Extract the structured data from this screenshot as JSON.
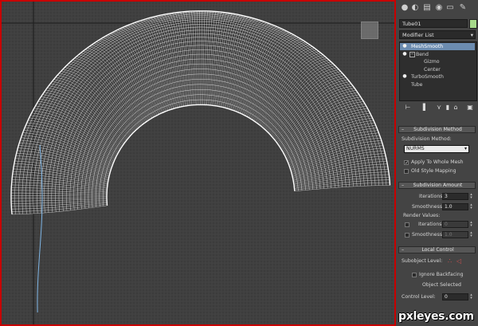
{
  "panel": {
    "object_name": "Tube01",
    "modifier_list": "Modifier List",
    "stack": [
      {
        "label": "MeshSmooth",
        "selected": true,
        "bulb": true,
        "expand": false
      },
      {
        "label": "Bend",
        "selected": false,
        "bulb": true,
        "expand": true
      },
      {
        "label": "Gizmo",
        "selected": false,
        "bulb": false,
        "expand": false
      },
      {
        "label": "Center",
        "selected": false,
        "bulb": false,
        "expand": false
      },
      {
        "label": "TurboSmooth",
        "selected": false,
        "bulb": true,
        "expand": false
      },
      {
        "label": "Tube",
        "selected": false,
        "bulb": false,
        "expand": false
      }
    ],
    "subdivision_method": {
      "title": "Subdivision Method",
      "field_label": "Subdivision Method:",
      "value": "NURMS",
      "apply_whole_mesh": "Apply To Whole Mesh",
      "apply_checked": true,
      "old_style": "Old Style Mapping",
      "old_style_checked": false
    },
    "subdivision_amount": {
      "title": "Subdivision Amount",
      "iterations_label": "Iterations:",
      "iterations": "3",
      "smoothness_label": "Smoothness:",
      "smoothness": "1.0",
      "render_values": "Render Values:",
      "r_iterations_label": "Iterations:",
      "r_iterations": "0",
      "r_smoothness_label": "Smoothness:",
      "r_smoothness": "1.0"
    },
    "local_control": {
      "title": "Local Control",
      "subobject_level": "Subobject Level:",
      "ignore_backfacing": "Ignore Backfacing",
      "object_selected": "Object Selected",
      "control_level": "Control Level:",
      "control_level_value": "0"
    }
  },
  "watermark": "pxleyes.com",
  "colors": {
    "viewport_bg": "#3c3c3c",
    "viewport_border": "#c80000",
    "wire": "#ffffff",
    "selection": "#6c8cb0"
  }
}
